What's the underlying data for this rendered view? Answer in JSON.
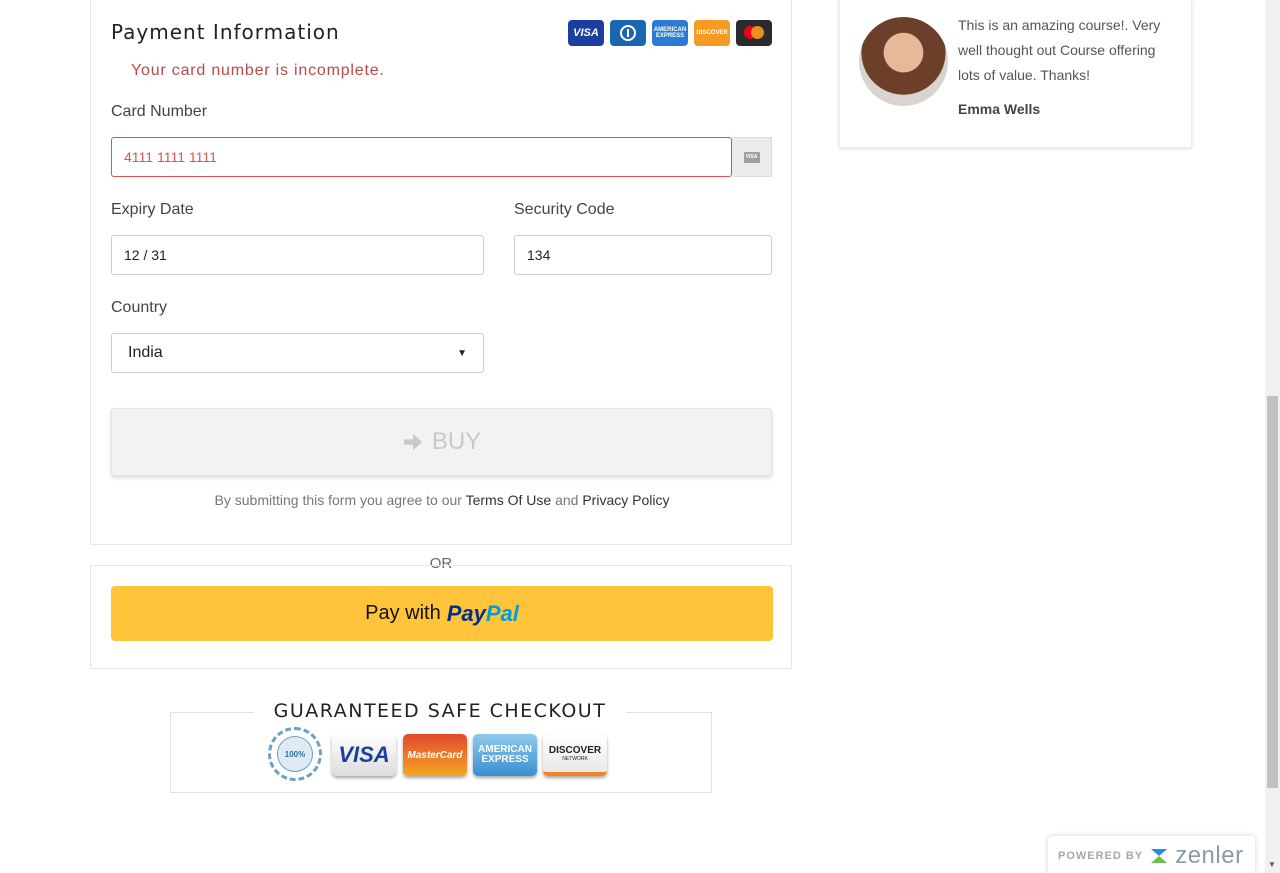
{
  "payment": {
    "title": "Payment Information",
    "error": "Your card number is incomplete.",
    "card_number_label": "Card Number",
    "card_number_value": "4111 1111 1111",
    "expiry_label": "Expiry Date",
    "expiry_value": "12 / 31",
    "security_label": "Security Code",
    "security_value": "134",
    "country_label": "Country",
    "country_value": "India",
    "buy_label": "BUY",
    "terms_prefix": "By submitting this form you agree to our",
    "terms_link": "Terms Of Use",
    "terms_and": "and",
    "privacy_link": "Privacy Policy",
    "card_logos": [
      "visa-logo",
      "diners-logo",
      "amex-logo",
      "discover-logo",
      "mastercard-logo"
    ],
    "card_logo_labels": {
      "visa": "VISA",
      "amex": "AMERICAN EXPRESS",
      "discover": "DISCOVER",
      "mini_visa": "VISA"
    }
  },
  "or_label": "OR",
  "paypal": {
    "pay_with": "Pay with",
    "brand_part1": "Pay",
    "brand_part2": "Pal",
    "color": "#ffc439"
  },
  "safe_checkout": {
    "title": "GUARANTEED SAFE CHECKOUT",
    "seal_text": "100%",
    "visa": "VISA",
    "mastercard": "MasterCard",
    "amex": "AMERICAN EXPRESS",
    "discover": "DISCOVER",
    "discover_sub": "NETWORK"
  },
  "testimonial": {
    "quote": "This is an amazing course!. Very well thought out Course offering lots of value. Thanks!",
    "author": "Emma Wells"
  },
  "powered_by": {
    "label": "POWERED BY",
    "brand": "zenler"
  },
  "colors": {
    "error": "#b94a48",
    "input_error_border": "#d9534f",
    "paypal_yellow": "#ffc439",
    "paypal_blue_dark": "#003087",
    "paypal_blue_light": "#009cde"
  }
}
